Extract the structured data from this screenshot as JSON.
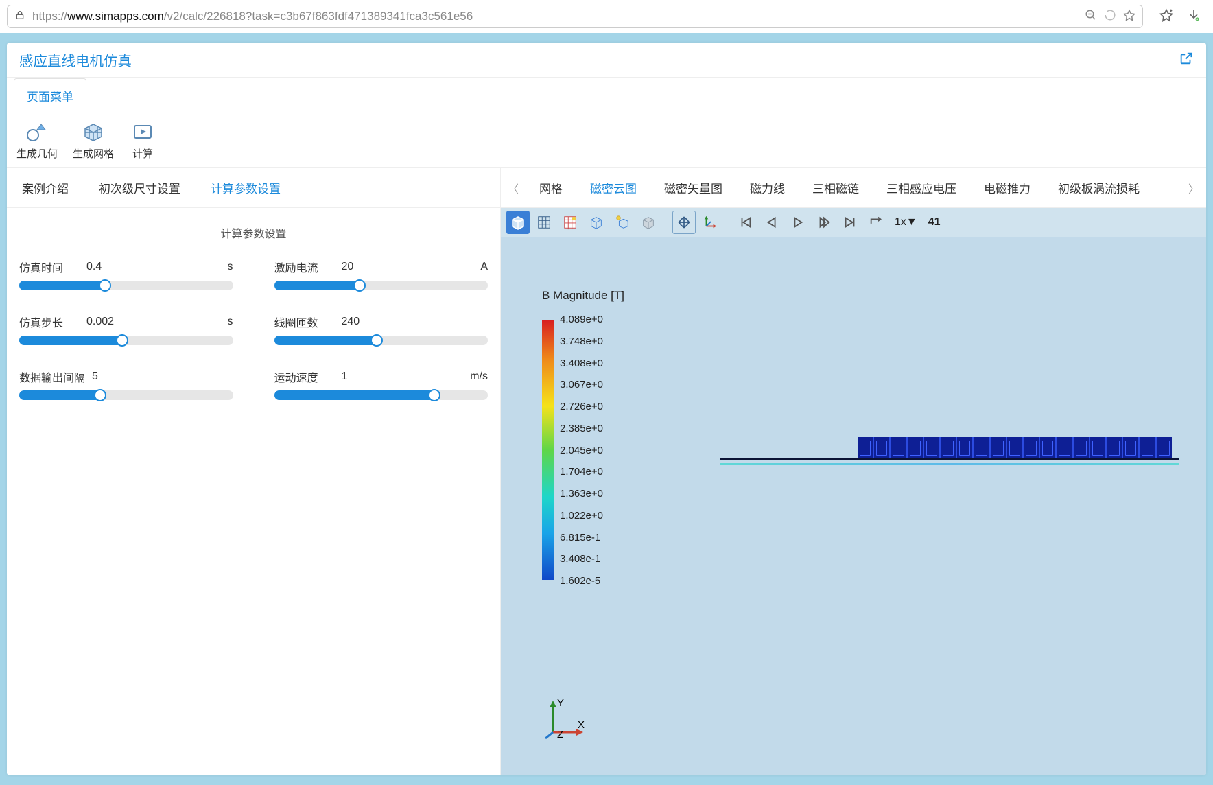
{
  "browser": {
    "url_prefix": "https://",
    "url_host": "www.simapps.com",
    "url_path": "/v2/calc/226818?task=c3b67f863fdf471389341fca3c561e56"
  },
  "app": {
    "title": "感应直线电机仿真",
    "menu_tab": "页面菜单",
    "ribbon": [
      {
        "label": "生成几何"
      },
      {
        "label": "生成网格"
      },
      {
        "label": "计算"
      }
    ]
  },
  "left_tabs": [
    "案例介绍",
    "初次级尺寸设置",
    "计算参数设置"
  ],
  "left_active": 2,
  "panel_title": "计算参数设置",
  "fields": [
    {
      "label": "仿真时间",
      "value": "0.4",
      "unit": "s",
      "pct": 40
    },
    {
      "label": "激励电流",
      "value": "20",
      "unit": "A",
      "pct": 40
    },
    {
      "label": "仿真步长",
      "value": "0.002",
      "unit": "s",
      "pct": 48
    },
    {
      "label": "线圈匝数",
      "value": "240",
      "unit": "",
      "pct": 48
    },
    {
      "label": "数据输出间隔",
      "value": "5",
      "unit": "",
      "pct": 38
    },
    {
      "label": "运动速度",
      "value": "1",
      "unit": "m/s",
      "pct": 75
    }
  ],
  "right_tabs": [
    "网格",
    "磁密云图",
    "磁密矢量图",
    "磁力线",
    "三相磁链",
    "三相感应电压",
    "电磁推力",
    "初级板涡流损耗"
  ],
  "right_active": 1,
  "playback": {
    "speed": "1x▼",
    "frame": "41"
  },
  "legend": {
    "title": "B Magnitude [T]",
    "values": [
      "4.089e+0",
      "3.748e+0",
      "3.408e+0",
      "3.067e+0",
      "2.726e+0",
      "2.385e+0",
      "2.045e+0",
      "1.704e+0",
      "1.363e+0",
      "1.022e+0",
      "6.815e-1",
      "3.408e-1",
      "1.602e-5"
    ]
  },
  "axes": {
    "y": "Y",
    "z": "Z",
    "x": "X"
  }
}
